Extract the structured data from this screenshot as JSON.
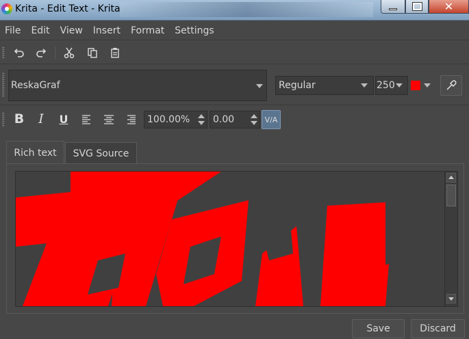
{
  "window": {
    "title": "Krita - Edit Text - Krita"
  },
  "menu": [
    "File",
    "Edit",
    "View",
    "Insert",
    "Format",
    "Settings"
  ],
  "toolbar1": {
    "icons": [
      "undo-icon",
      "redo-icon",
      "cut-icon",
      "copy-icon",
      "paste-icon"
    ]
  },
  "font": {
    "family": "ReskaGraf",
    "style": "Regular",
    "size": "250",
    "color": "#ff0000"
  },
  "format": {
    "bold": "B",
    "italic": "I",
    "underline": "U",
    "line_height": "100.00%",
    "letter_spacing": "0.00",
    "kerning_label": "V/A"
  },
  "tabs": [
    {
      "label": "Rich text",
      "active": true
    },
    {
      "label": "SVG Source",
      "active": false
    }
  ],
  "buttons": {
    "save": "Save",
    "discard": "Discard"
  }
}
